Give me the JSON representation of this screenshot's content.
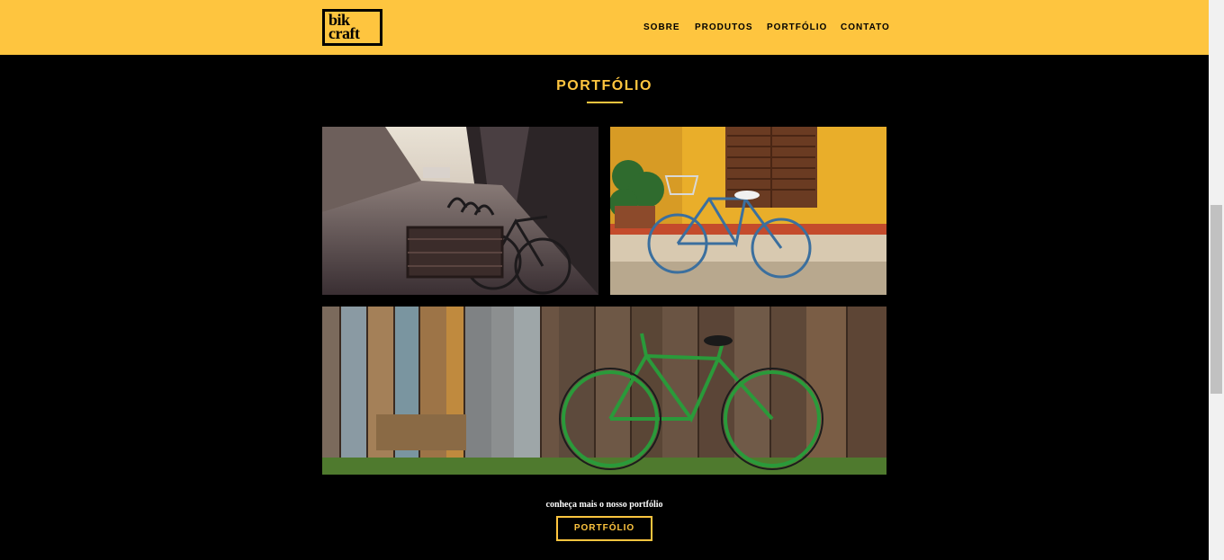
{
  "header": {
    "logo_line1": "bik",
    "logo_line2": "craft",
    "background": "#fec53f",
    "nav": [
      {
        "label": "SOBRE"
      },
      {
        "label": "PRODUTOS"
      },
      {
        "label": "PORTFÓLIO"
      },
      {
        "label": "CONTATO"
      }
    ]
  },
  "section": {
    "title": "PORTFÓLIO",
    "accent": "#fec53f"
  },
  "gallery": [
    {
      "subject": "city street with parked bicycle and basket"
    },
    {
      "subject": "blue bicycle in front of yellow wall"
    },
    {
      "subject": "green bicycle leaning on wooden fence"
    }
  ],
  "cta": {
    "text": "conheça mais o nosso portfólio",
    "button_label": "PORTFÓLIO"
  }
}
